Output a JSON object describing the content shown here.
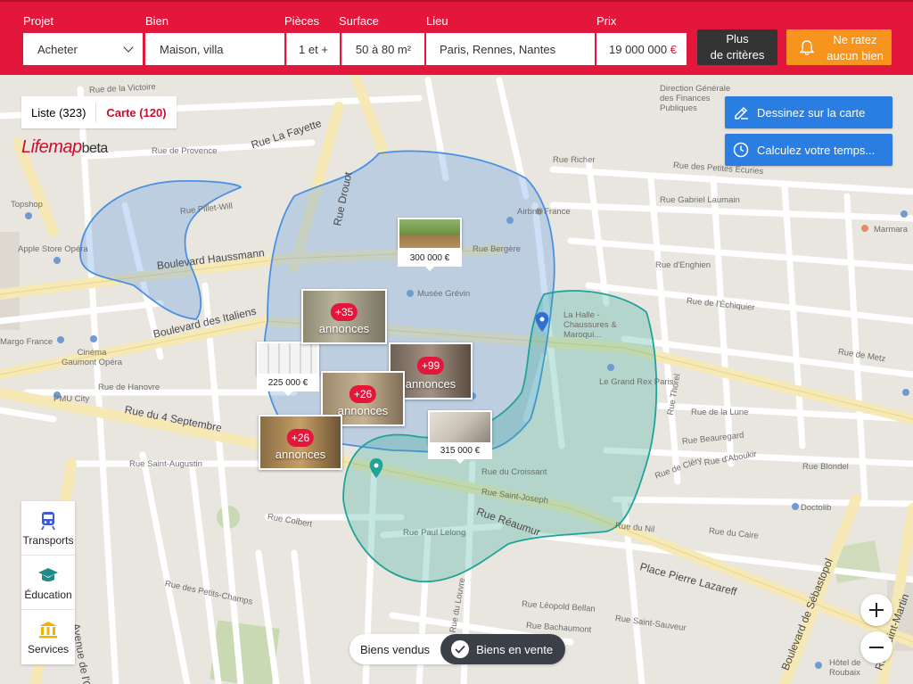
{
  "header": {
    "projet": {
      "label": "Projet",
      "value": "Acheter"
    },
    "bien": {
      "label": "Bien",
      "value": "Maison, villa"
    },
    "pieces": {
      "label": "Pièces",
      "value": "1 et +"
    },
    "surface": {
      "label": "Surface",
      "value": "50 à 80 m²"
    },
    "lieu": {
      "label": "Lieu",
      "value": "Paris, Rennes, Nantes"
    },
    "prix": {
      "label": "Prix",
      "value": "19 000 000",
      "currency": "€"
    },
    "criteria_line1": "Plus",
    "criteria_line2": "de critères",
    "alert_line1": "Ne ratez",
    "alert_line2": "aucun bien"
  },
  "view": {
    "list_label": "Liste (323)",
    "map_label": "Carte (120)"
  },
  "logo": {
    "brand": "Lifemap",
    "suffix": "beta"
  },
  "tools": {
    "draw_label": "Dessinez sur la carte",
    "time_label": "Calculez votre temps..."
  },
  "listings": {
    "price_1": "300 000 €",
    "price_2": "225 000 €",
    "price_3": "315 000 €",
    "group_1": {
      "count": "+35",
      "label": "annonces"
    },
    "group_2": {
      "count": "+99",
      "label": "annonces"
    },
    "group_3": {
      "count": "+26",
      "label": "annonces"
    },
    "group_4": {
      "count": "+26",
      "label": "annonces"
    }
  },
  "categories": {
    "transports": "Transports",
    "education": "Éducation",
    "services": "Services"
  },
  "sold_toggle": {
    "sold_label": "Biens vendus",
    "sale_label": "Biens en vente"
  },
  "zoom": {
    "in": "+",
    "out": "−"
  },
  "colors": {
    "brand_red": "#e3163b",
    "blue_zone": "#4a90e2",
    "teal_zone": "#2aa198",
    "orange": "#f7941d"
  },
  "map_labels": {
    "bd_haussmann": "Boulevard Haussmann",
    "bd_italiens": "Boulevard des Italiens",
    "rue_4_sept": "Rue du 4 Septembre",
    "rue_reaumur": "Rue Réaumur",
    "place_lazareff": "Place Pierre Lazareff",
    "bd_sebastopol": "Boulevard de Sébastopol",
    "av_opera": "Avenue de l'Opéra",
    "rue_lafayette": "Rue La Fayette",
    "rue_drouot": "Rue Drouot",
    "rue_st_martin": "Rue Saint-Martin",
    "rue_victoire": "Rue de la Victoire",
    "rue_provence": "Rue de Provence",
    "rue_hanovre": "Rue de Hanovre",
    "rue_st_augustin": "Rue Saint-Augustin",
    "rue_colbert": "Rue Colbert",
    "rue_petits_champs": "Rue des Petits-Champs",
    "rue_richer": "Rue Richer",
    "rue_petites_ecuries": "Rue des Petites Écuries",
    "rue_echiquier": "Rue de l'Échiquier",
    "rue_metz": "Rue de Metz",
    "rue_lune": "Rue de la Lune",
    "rue_cairo": "Rue du Caire",
    "rue_blondel": "Rue Blondel",
    "rue_aboukir": "Rue d'Aboukir",
    "rue_nil": "Rue du Nil",
    "rue_paul_lelong": "Rue Paul Lelong",
    "rue_louvre": "Rue du Louvre",
    "rue_gabriel_laumain": "Rue Gabriel Laumain",
    "rue_enghien": "Rue d'Enghien",
    "rue_bergere": "Rue Bergère",
    "rue_pillet_will": "Rue Pillet-Will",
    "rue_croissant": "Rue du Croissant",
    "rue_st_joseph": "Rue Saint-Joseph",
    "musee_grevin": "Musée Grévin",
    "grand_rex": "Le Grand Rex Paris",
    "la_halle": "La Halle - Chaussures & Maroqui...",
    "apple_store": "Apple Store Opéra",
    "topshop": "Topshop",
    "marmara": "Marmara",
    "doctolib": "Doctolib",
    "pmu_city": "PMU City",
    "cinema_gaumont": "Cinéma Gaumont Opéra",
    "airbnb": "Airbnb France",
    "margo": "Margo France",
    "hotel_roubaix": "Hôtel de Roubaix",
    "finances": "Direction Générale des Finances Publiques",
    "leopold": "Rue Léopold Bellan",
    "rue_bachaumont": "Rue Bachaumont",
    "rue_st_sauveur": "Rue Saint-Sauveur",
    "rue_thorel": "Rue Thorel",
    "rue_beauregard": "Rue Beauregard",
    "rue_clery": "Rue de Cléry"
  }
}
